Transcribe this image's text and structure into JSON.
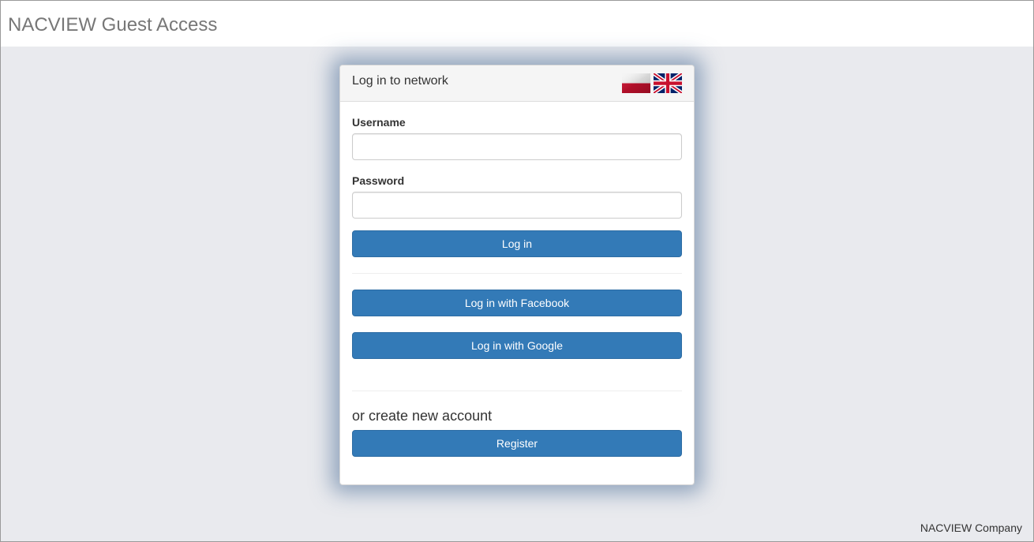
{
  "header": {
    "title": "NACVIEW Guest Access"
  },
  "login_panel": {
    "title": "Log in to network",
    "languages": [
      {
        "code": "pl",
        "icon": "poland-flag-icon"
      },
      {
        "code": "en",
        "icon": "uk-flag-icon"
      }
    ],
    "username_label": "Username",
    "username_value": "",
    "password_label": "Password",
    "password_value": "",
    "login_button": "Log in",
    "facebook_button": "Log in with Facebook",
    "google_button": "Log in with Google",
    "create_account_text": "or create new account",
    "register_button": "Register"
  },
  "footer": {
    "company": "NACVIEW Company"
  },
  "colors": {
    "primary_button": "#337ab7",
    "page_background": "#e9eaee",
    "panel_glow": "#486c96"
  }
}
